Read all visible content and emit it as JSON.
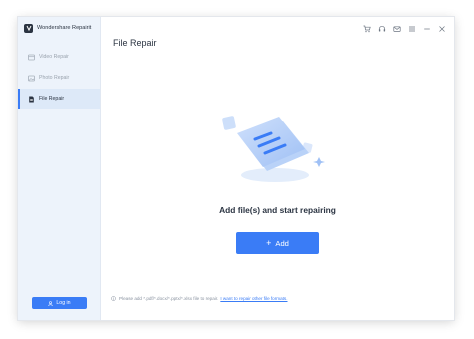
{
  "app": {
    "name": "Wondershare Repairit"
  },
  "sidebar": {
    "items": [
      {
        "label": "Video Repair",
        "icon": "video-icon",
        "active": false
      },
      {
        "label": "Photo Repair",
        "icon": "image-icon",
        "active": false
      },
      {
        "label": "File Repair",
        "icon": "file-icon",
        "active": true
      }
    ],
    "login_label": "Log in"
  },
  "titlebar": {
    "icons": [
      "cart-icon",
      "headset-icon",
      "mail-icon",
      "menu-icon",
      "minimize-icon",
      "close-icon"
    ]
  },
  "main": {
    "title": "File Repair",
    "headline": "Add file(s) and start repairing",
    "add_button_label": "Add",
    "footer_text": "Please add *.pdf/*.docx/*.pptx/*.xlsx file to repair.",
    "footer_link": "I want to repair other file formats."
  },
  "colors": {
    "accent": "#3a7cf6",
    "sidebar_bg": "#edf3fb",
    "active_item_bg": "#dde9f8",
    "text_dark": "#2b3442",
    "text_muted": "#9aa3ae"
  }
}
